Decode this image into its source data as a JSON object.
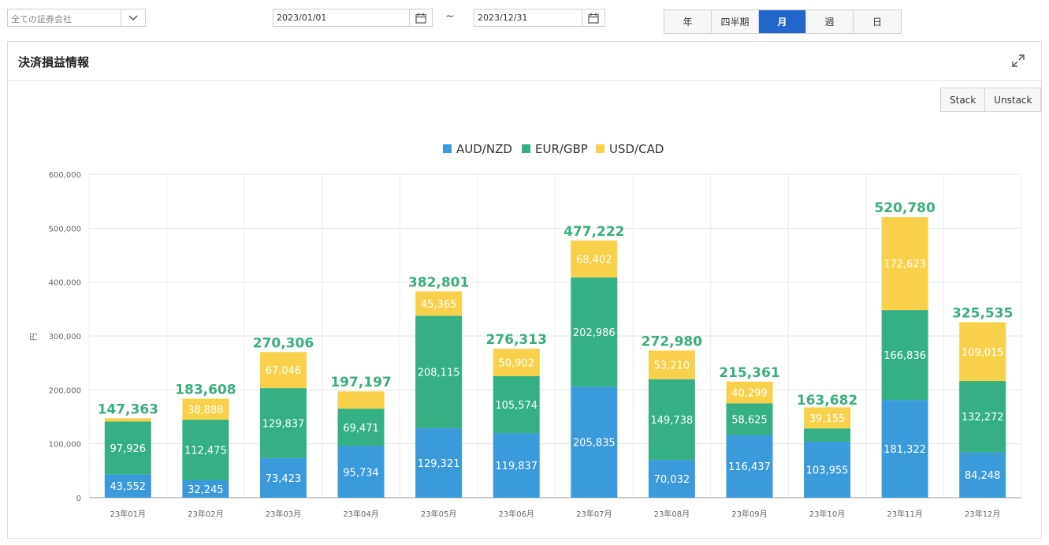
{
  "filters": {
    "broker_select": "全ての証券会社",
    "date_from": "2023/01/01",
    "date_separator": "~",
    "date_to": "2023/12/31"
  },
  "period_tabs": [
    {
      "label": "年",
      "active": false
    },
    {
      "label": "四半期",
      "active": false
    },
    {
      "label": "月",
      "active": true
    },
    {
      "label": "週",
      "active": false
    },
    {
      "label": "日",
      "active": false
    }
  ],
  "panel": {
    "title": "決済損益情報",
    "stack_label": "Stack",
    "unstack_label": "Unstack"
  },
  "colors": {
    "AUD/NZD": "#3b9ad9",
    "EUR/GBP": "#35b084",
    "USD/CAD": "#f8d04a",
    "total_label": "#3aae7c",
    "active_tab": "#2266cc"
  },
  "chart_data": {
    "type": "bar",
    "stacked": true,
    "categories": [
      "23年01月",
      "23年02月",
      "23年03月",
      "23年04月",
      "23年05月",
      "23年06月",
      "23年07月",
      "23年08月",
      "23年09月",
      "23年10月",
      "23年11月",
      "23年12月"
    ],
    "series": [
      {
        "name": "AUD/NZD",
        "values": [
          43552,
          32245,
          73423,
          95734,
          129321,
          119837,
          205835,
          70032,
          116437,
          103955,
          181322,
          84248
        ]
      },
      {
        "name": "EUR/GBP",
        "values": [
          97926,
          112475,
          129837,
          69471,
          208115,
          105574,
          202986,
          149738,
          58625,
          24572,
          166836,
          132272
        ]
      },
      {
        "name": "USD/CAD",
        "values": [
          5885,
          38888,
          67046,
          31992,
          45365,
          50902,
          68402,
          53210,
          40299,
          39155,
          172623,
          109015
        ]
      }
    ],
    "segment_labels_shown": [
      [
        true,
        true,
        true,
        true,
        true,
        true,
        true,
        true,
        true,
        true,
        true,
        true
      ],
      [
        true,
        true,
        true,
        true,
        true,
        true,
        true,
        true,
        true,
        false,
        true,
        true
      ],
      [
        false,
        true,
        true,
        false,
        true,
        true,
        true,
        true,
        true,
        true,
        true,
        true
      ]
    ],
    "totals": [
      147363,
      183608,
      270306,
      197197,
      382801,
      276313,
      477222,
      272980,
      215361,
      163682,
      520780,
      325535
    ],
    "ylabel": "円",
    "ylim": [
      0,
      600000
    ],
    "yticks": [
      0,
      100000,
      200000,
      300000,
      400000,
      500000,
      600000
    ],
    "grid": true,
    "legend_position": "top-center"
  }
}
